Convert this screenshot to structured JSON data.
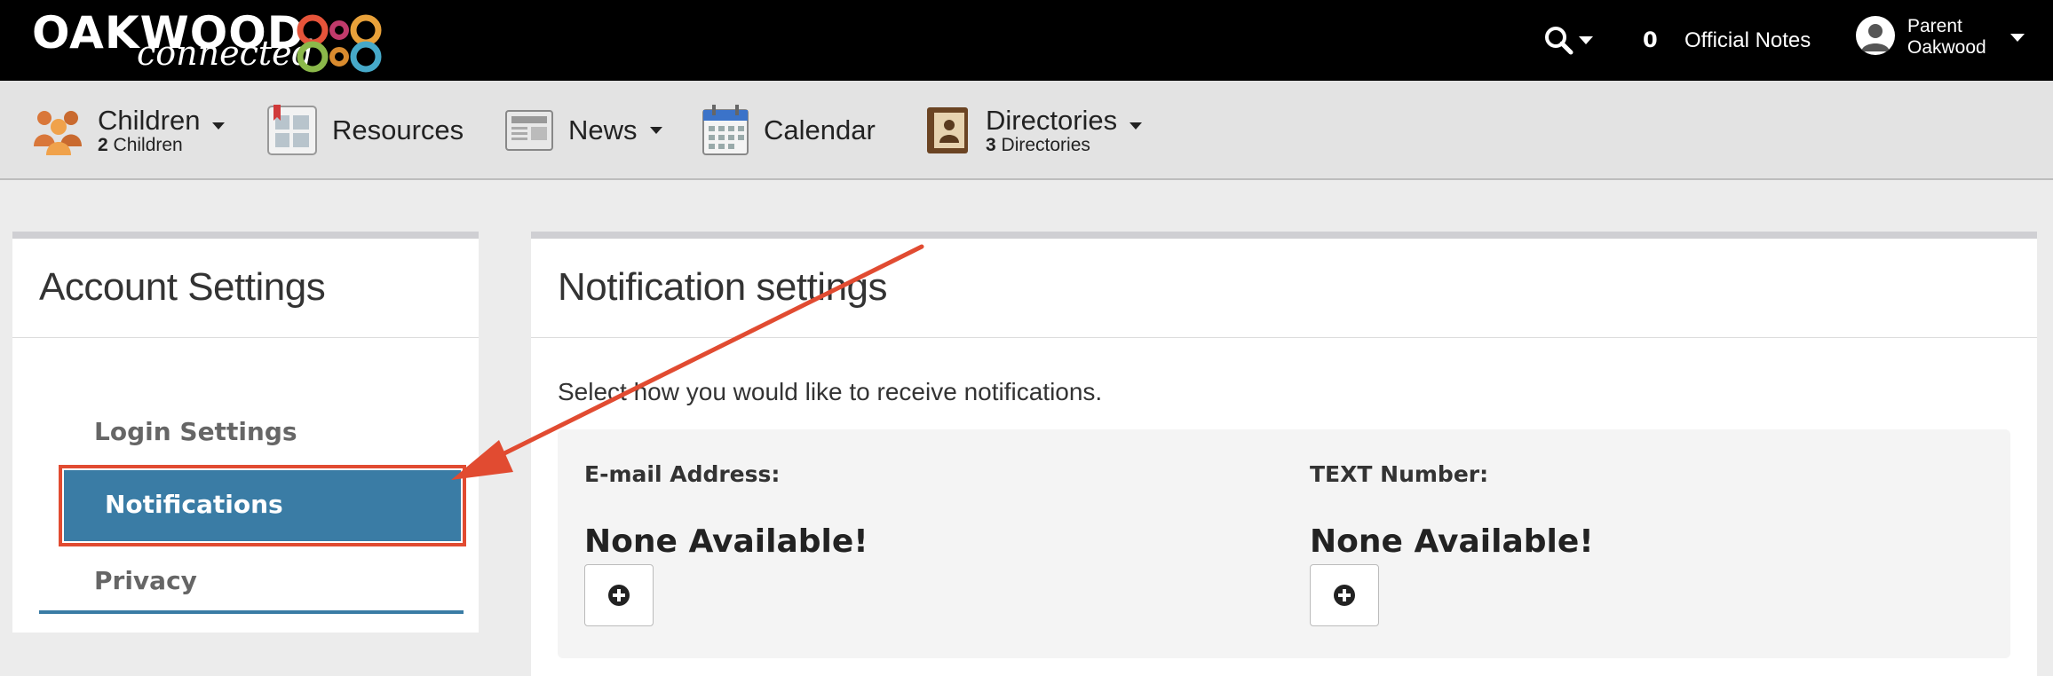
{
  "header": {
    "logo": {
      "word1": "OAKWOOD",
      "word2": "connected"
    },
    "official_notes_count": "0",
    "official_notes_label": "Official Notes",
    "user": {
      "line1": "Parent",
      "line2": "Oakwood"
    }
  },
  "nav": {
    "children": {
      "label": "Children",
      "sub_count": "2",
      "sub_label": "Children"
    },
    "resources": {
      "label": "Resources"
    },
    "news": {
      "label": "News"
    },
    "calendar": {
      "label": "Calendar"
    },
    "directories": {
      "label": "Directories",
      "sub_count": "3",
      "sub_label": "Directories"
    }
  },
  "sidebar": {
    "title": "Account Settings",
    "items": [
      {
        "label": "Login Settings"
      },
      {
        "label": "Notifications"
      },
      {
        "label": "Privacy"
      }
    ]
  },
  "main": {
    "title": "Notification settings",
    "intro": "Select how you would like to receive notifications.",
    "email": {
      "label": "E-mail Address:",
      "value": "None Available!"
    },
    "text": {
      "label": "TEXT Number:",
      "value": "None Available!"
    }
  },
  "colors": {
    "accent": "#3a7ca5",
    "annotation": "#e14b31",
    "topbar": "#000000"
  }
}
